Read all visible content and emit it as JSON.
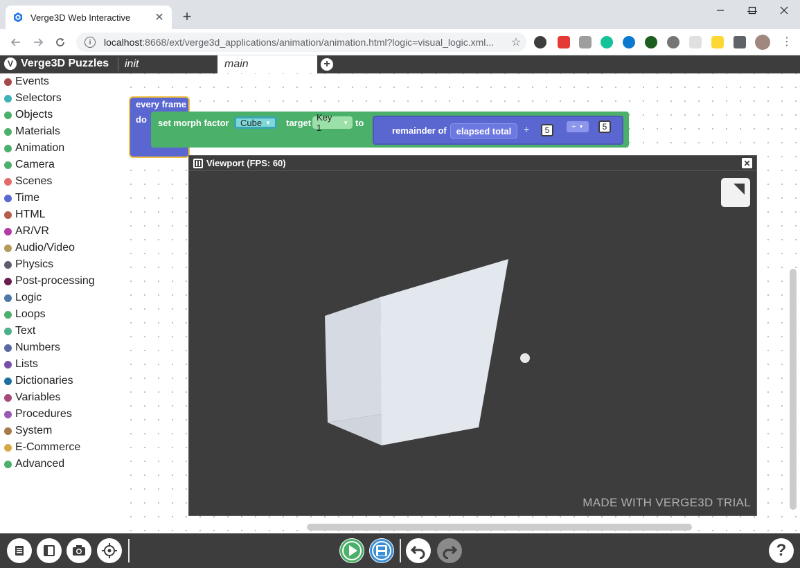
{
  "browser": {
    "tab_title": "Verge3D Web Interactive",
    "tab_close": "✕",
    "new_tab": "+",
    "url_host": "localhost",
    "url_rest": ":8668/ext/verge3d_applications/animation/animation.html?logic=visual_logic.xml...",
    "window_controls": {
      "minimize": "—",
      "maximize": "☐",
      "close": "✕"
    }
  },
  "puzzles": {
    "app_title": "Verge3D Puzzles",
    "workspace_tabs": [
      "init",
      "main"
    ],
    "active_tab": "main",
    "add_tab": "+"
  },
  "categories": [
    {
      "label": "Events",
      "color": "#a6474a"
    },
    {
      "label": "Selectors",
      "color": "#40b1b6"
    },
    {
      "label": "Objects",
      "color": "#4bb06a"
    },
    {
      "label": "Materials",
      "color": "#4bb06a"
    },
    {
      "label": "Animation",
      "color": "#4bb06a"
    },
    {
      "label": "Camera",
      "color": "#4bb06a"
    },
    {
      "label": "Scenes",
      "color": "#e56a6a"
    },
    {
      "label": "Time",
      "color": "#5b67d1"
    },
    {
      "label": "HTML",
      "color": "#b65c4c"
    },
    {
      "label": "AR/VR",
      "color": "#b63aa6"
    },
    {
      "label": "Audio/Video",
      "color": "#b59a5a"
    },
    {
      "label": "Physics",
      "color": "#5e5e6e"
    },
    {
      "label": "Post-processing",
      "color": "#6a1e4e"
    },
    {
      "label": "Logic",
      "color": "#4b7aa8"
    },
    {
      "label": "Loops",
      "color": "#4bb06a"
    },
    {
      "label": "Text",
      "color": "#4bb08a"
    },
    {
      "label": "Numbers",
      "color": "#5b67a1"
    },
    {
      "label": "Lists",
      "color": "#7650a8"
    },
    {
      "label": "Dictionaries",
      "color": "#1f6fa0"
    },
    {
      "label": "Variables",
      "color": "#a6497a"
    },
    {
      "label": "Procedures",
      "color": "#9a59b5"
    },
    {
      "label": "System",
      "color": "#a67a4a"
    },
    {
      "label": "E-Commerce",
      "color": "#d6a846"
    },
    {
      "label": "Advanced",
      "color": "#4bb06a"
    }
  ],
  "blocks": {
    "every_frame": "every frame",
    "do": "do",
    "set_morph": "set morph factor",
    "object": "Cube",
    "target_label": "target",
    "key": "Key 1",
    "to_label": "to",
    "remainder": "remainder of",
    "elapsed": "elapsed total",
    "div_symbol": "÷",
    "div_operand": "5",
    "remainder_operand": "5"
  },
  "viewport": {
    "title": "Viewport (FPS: 60)",
    "close": "✕",
    "watermark": "MADE WITH VERGE3D TRIAL"
  },
  "bottom_bar": {
    "help": "?"
  },
  "colors": {
    "header": "#3d3d3d",
    "event_block": "#5b67d1",
    "object_block": "#4bb06a",
    "play": "#4bb06a",
    "save": "#3a8fd6"
  }
}
